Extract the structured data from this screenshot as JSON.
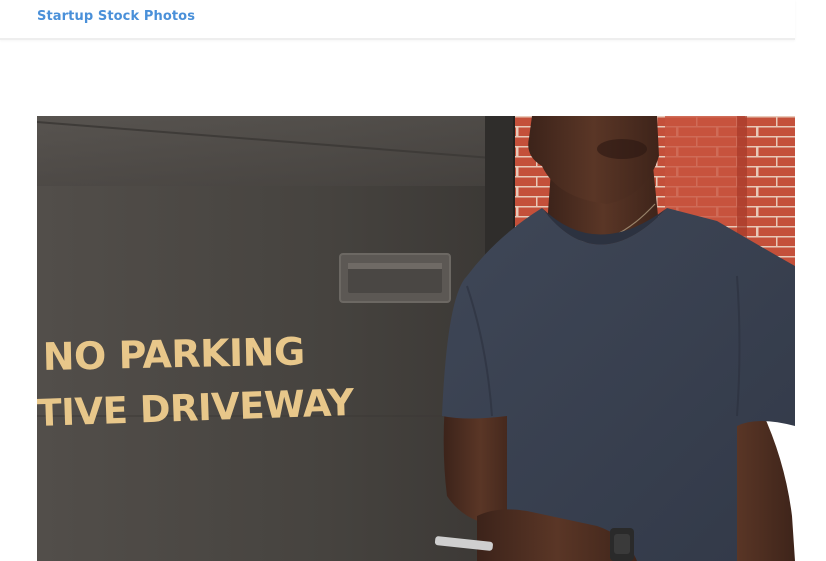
{
  "header": {
    "site_title": "Startup Stock Photos"
  },
  "photo": {
    "sign_line_1": "NO PARKING",
    "sign_line_2": "TIVE DRIVEWAY",
    "colors": {
      "wall": "#4b4845",
      "brick": "#c24a35",
      "shirt": "#3a4150",
      "skin": "#4a2c20",
      "sign_text": "#e8c78a"
    }
  },
  "colors": {
    "accent": "#4a90d9",
    "header_border": "#eeeeee",
    "background": "#ffffff"
  }
}
